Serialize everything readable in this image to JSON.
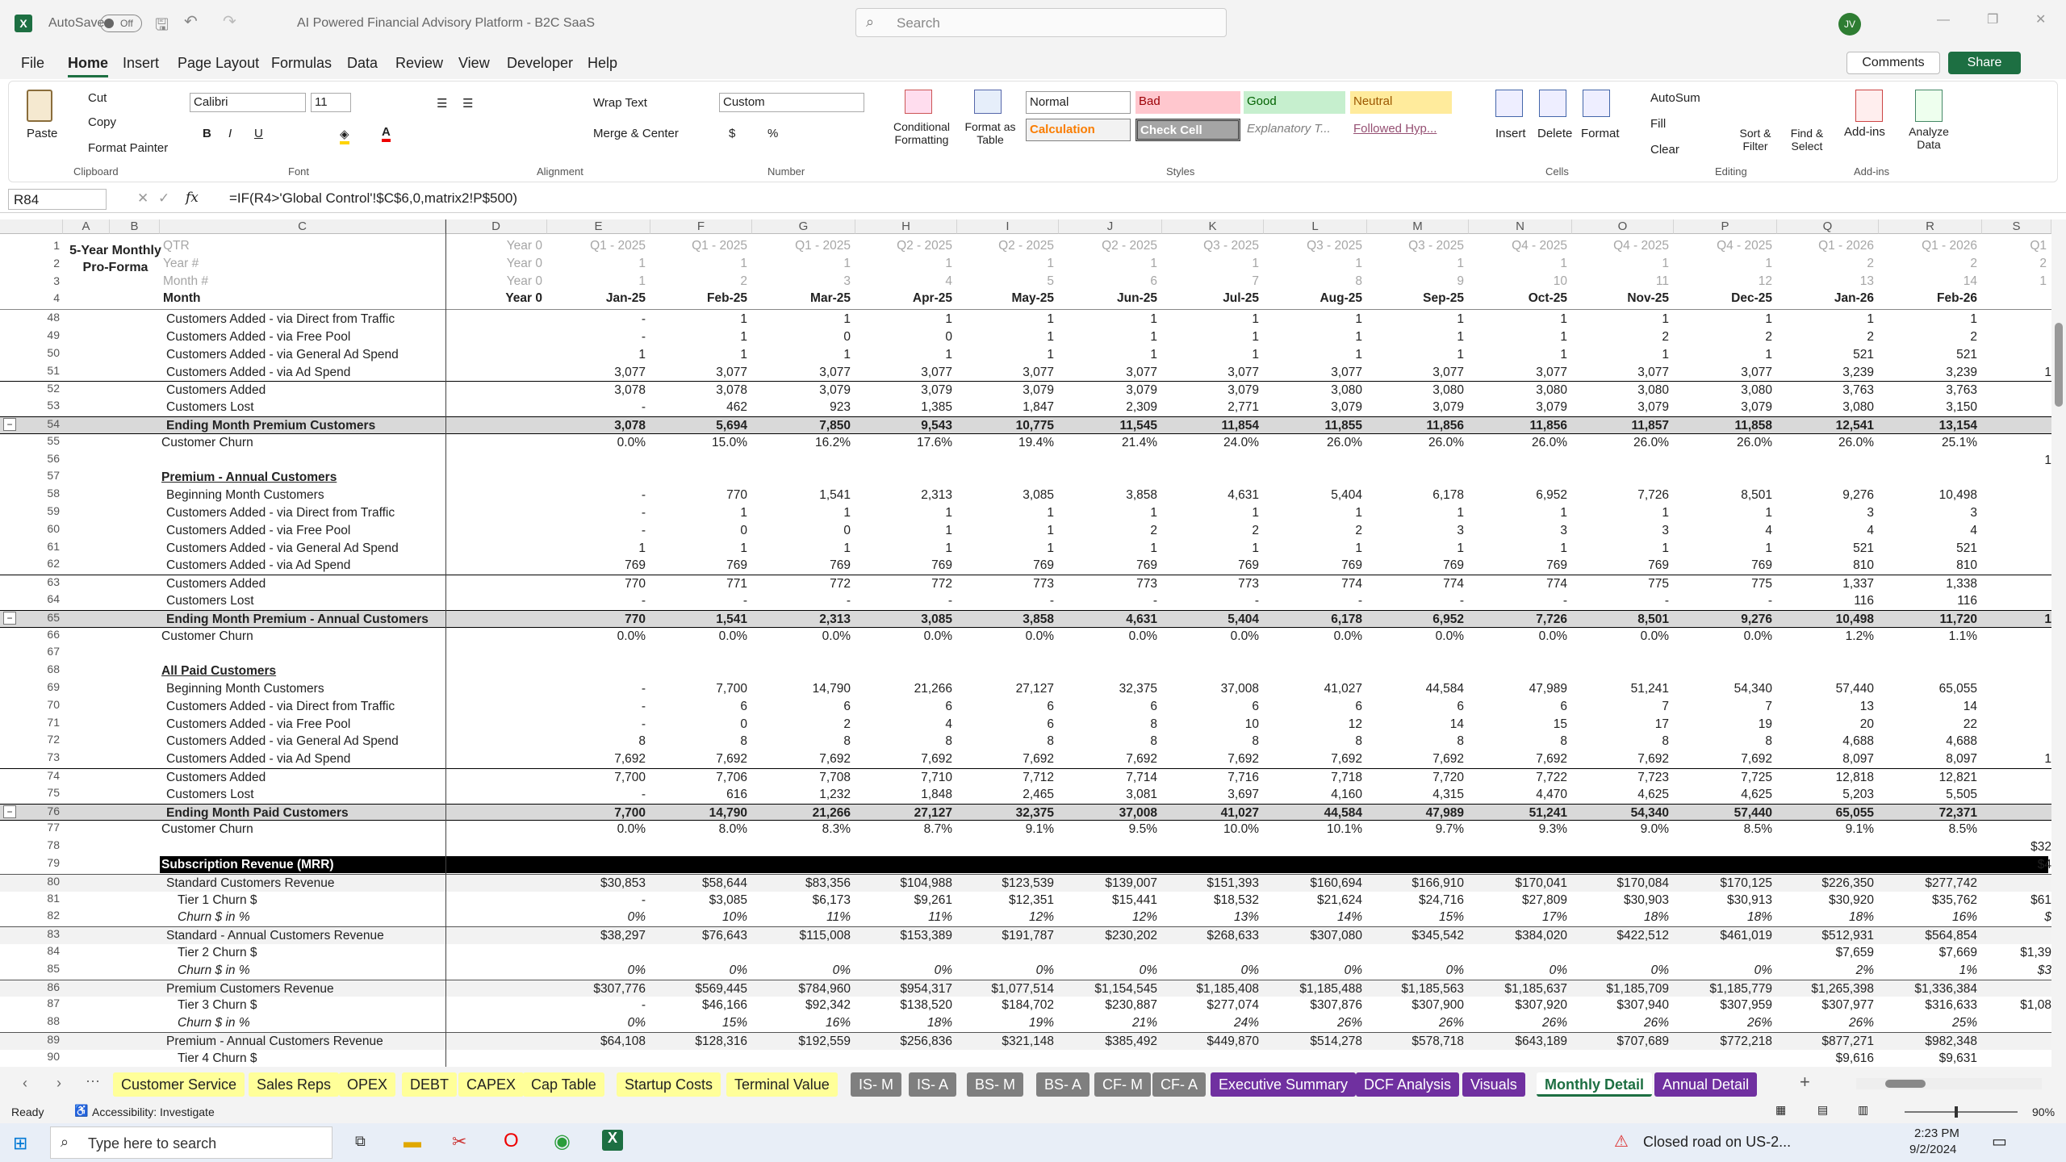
{
  "app": {
    "title": "AI Powered Financial Advisory Platform - B2C SaaS",
    "autosave": "AutoSave",
    "autosave_state": "Off",
    "search_placeholder": "Search",
    "user_initials": "JV"
  },
  "menu": [
    "File",
    "Home",
    "Insert",
    "Page Layout",
    "Formulas",
    "Data",
    "Review",
    "View",
    "Developer",
    "Help"
  ],
  "menu_right": {
    "comments": "Comments",
    "share": "Share"
  },
  "ribbon": {
    "clipboard": {
      "paste": "Paste",
      "cut": "Cut",
      "copy": "Copy",
      "format_painter": "Format Painter",
      "group": "Clipboard"
    },
    "font": {
      "name": "Calibri",
      "size": "11",
      "group": "Font"
    },
    "alignment": {
      "wrap": "Wrap Text",
      "merge": "Merge & Center",
      "group": "Alignment"
    },
    "number": {
      "format": "Custom",
      "group": "Number"
    },
    "styles": {
      "cond": "Conditional Formatting",
      "table": "Format as Table",
      "normal": "Normal",
      "bad": "Bad",
      "good": "Good",
      "neutral": "Neutral",
      "calc": "Calculation",
      "check": "Check Cell",
      "expl": "Explanatory T...",
      "follow": "Followed Hyp...",
      "group": "Styles"
    },
    "cells": {
      "insert": "Insert",
      "delete": "Delete",
      "format": "Format",
      "group": "Cells"
    },
    "editing": {
      "autosum": "AutoSum",
      "fill": "Fill",
      "clear": "Clear",
      "sort": "Sort & Filter",
      "find": "Find & Select",
      "group": "Editing"
    },
    "addins": {
      "addins": "Add-ins",
      "analyze": "Analyze Data",
      "group": "Add-ins"
    }
  },
  "formula_bar": {
    "name_box": "R84",
    "formula": "=IF(R4>'Global Control'!$C$6,0,matrix2!P$500)"
  },
  "columns": [
    "A",
    "B",
    "C",
    "D",
    "E",
    "F",
    "G",
    "H",
    "I",
    "J",
    "K",
    "L",
    "M",
    "N",
    "O",
    "P",
    "Q",
    "R",
    "S"
  ],
  "header_rows": {
    "title": "5-Year Monthly Pro-Forma",
    "r1": [
      "QTR",
      "Year 0",
      "Q1 - 2025",
      "Q1 - 2025",
      "Q1 - 2025",
      "Q2 - 2025",
      "Q2 - 2025",
      "Q2 - 2025",
      "Q3 - 2025",
      "Q3 - 2025",
      "Q3 - 2025",
      "Q4 - 2025",
      "Q4 - 2025",
      "Q4 - 2025",
      "Q1 - 2026",
      "Q1 - 2026",
      "Q1"
    ],
    "r2": [
      "Year #",
      "Year 0",
      "1",
      "1",
      "1",
      "1",
      "1",
      "1",
      "1",
      "1",
      "1",
      "1",
      "1",
      "1",
      "2",
      "2",
      "2"
    ],
    "r3": [
      "Month #",
      "Year 0",
      "1",
      "2",
      "3",
      "4",
      "5",
      "6",
      "7",
      "8",
      "9",
      "10",
      "11",
      "12",
      "13",
      "14",
      "1"
    ],
    "r4": [
      "Month",
      "Year 0",
      "Jan-25",
      "Feb-25",
      "Mar-25",
      "Apr-25",
      "May-25",
      "Jun-25",
      "Jul-25",
      "Aug-25",
      "Sep-25",
      "Oct-25",
      "Nov-25",
      "Dec-25",
      "Jan-26",
      "Feb-26",
      ""
    ]
  },
  "rows": [
    {
      "n": "48",
      "l": "Customers Added - via Direct from Traffic",
      "v": [
        "",
        "-",
        "1",
        "1",
        "1",
        "1",
        "1",
        "1",
        "1",
        "1",
        "1",
        "1",
        "1",
        "1",
        "1"
      ]
    },
    {
      "n": "49",
      "l": "Customers Added - via Free Pool",
      "v": [
        "",
        "-",
        "1",
        "0",
        "0",
        "1",
        "1",
        "1",
        "1",
        "1",
        "1",
        "2",
        "2",
        "2",
        "2"
      ]
    },
    {
      "n": "50",
      "l": "Customers Added - via General Ad Spend",
      "v": [
        "",
        "1",
        "1",
        "1",
        "1",
        "1",
        "1",
        "1",
        "1",
        "1",
        "1",
        "1",
        "1",
        "521",
        "521"
      ]
    },
    {
      "n": "51",
      "l": "Customers Added - via Ad Spend",
      "v": [
        "",
        "3,077",
        "3,077",
        "3,077",
        "3,077",
        "3,077",
        "3,077",
        "3,077",
        "3,077",
        "3,077",
        "3,077",
        "3,077",
        "3,077",
        "3,239",
        "3,239"
      ]
    },
    {
      "n": "52",
      "l": "Customers Added",
      "v": [
        "",
        "3,078",
        "3,078",
        "3,079",
        "3,079",
        "3,079",
        "3,079",
        "3,079",
        "3,080",
        "3,080",
        "3,080",
        "3,080",
        "3,080",
        "3,763",
        "3,763"
      ],
      "t": "top"
    },
    {
      "n": "53",
      "l": "Customers Lost",
      "v": [
        "",
        "-",
        "462",
        "923",
        "1,385",
        "1,847",
        "2,309",
        "2,771",
        "3,079",
        "3,079",
        "3,079",
        "3,079",
        "3,079",
        "3,080",
        "3,150"
      ]
    },
    {
      "n": "54",
      "l": "Ending Month Premium Customers",
      "v": [
        "",
        "3,078",
        "5,694",
        "7,850",
        "9,543",
        "10,775",
        "11,545",
        "11,854",
        "11,855",
        "11,856",
        "11,856",
        "11,857",
        "11,858",
        "12,541",
        "13,154"
      ],
      "t": "end"
    },
    {
      "n": "55",
      "l": "Customer Churn",
      "v": [
        "",
        "0.0%",
        "15.0%",
        "16.2%",
        "17.6%",
        "19.4%",
        "21.4%",
        "24.0%",
        "26.0%",
        "26.0%",
        "26.0%",
        "26.0%",
        "26.0%",
        "26.0%",
        "25.1%"
      ],
      "t": "plain"
    },
    {
      "n": "56",
      "l": "",
      "v": []
    },
    {
      "n": "57",
      "l": "Premium - Annual Customers",
      "v": [],
      "t": "sec"
    },
    {
      "n": "58",
      "l": "Beginning Month Customers",
      "v": [
        "",
        "-",
        "770",
        "1,541",
        "2,313",
        "3,085",
        "3,858",
        "4,631",
        "5,404",
        "6,178",
        "6,952",
        "7,726",
        "8,501",
        "9,276",
        "10,498"
      ]
    },
    {
      "n": "59",
      "l": "Customers Added - via Direct from Traffic",
      "v": [
        "",
        "-",
        "1",
        "1",
        "1",
        "1",
        "1",
        "1",
        "1",
        "1",
        "1",
        "1",
        "1",
        "3",
        "3"
      ]
    },
    {
      "n": "60",
      "l": "Customers Added - via Free Pool",
      "v": [
        "",
        "-",
        "0",
        "0",
        "1",
        "1",
        "2",
        "2",
        "2",
        "3",
        "3",
        "3",
        "4",
        "4",
        "4"
      ]
    },
    {
      "n": "61",
      "l": "Customers Added - via General Ad Spend",
      "v": [
        "",
        "1",
        "1",
        "1",
        "1",
        "1",
        "1",
        "1",
        "1",
        "1",
        "1",
        "1",
        "1",
        "521",
        "521"
      ]
    },
    {
      "n": "62",
      "l": "Customers Added - via Ad Spend",
      "v": [
        "",
        "769",
        "769",
        "769",
        "769",
        "769",
        "769",
        "769",
        "769",
        "769",
        "769",
        "769",
        "769",
        "810",
        "810"
      ]
    },
    {
      "n": "63",
      "l": "Customers Added",
      "v": [
        "",
        "770",
        "771",
        "772",
        "772",
        "773",
        "773",
        "773",
        "774",
        "774",
        "774",
        "775",
        "775",
        "1,337",
        "1,338"
      ],
      "t": "top"
    },
    {
      "n": "64",
      "l": "Customers Lost",
      "v": [
        "",
        "-",
        "-",
        "-",
        "-",
        "-",
        "-",
        "-",
        "-",
        "-",
        "-",
        "-",
        "-",
        "116",
        "116"
      ]
    },
    {
      "n": "65",
      "l": "Ending Month Premium - Annual Customers",
      "v": [
        "",
        "770",
        "1,541",
        "2,313",
        "3,085",
        "3,858",
        "4,631",
        "5,404",
        "6,178",
        "6,952",
        "7,726",
        "8,501",
        "9,276",
        "10,498",
        "11,720"
      ],
      "t": "end"
    },
    {
      "n": "66",
      "l": "Customer Churn",
      "v": [
        "",
        "0.0%",
        "0.0%",
        "0.0%",
        "0.0%",
        "0.0%",
        "0.0%",
        "0.0%",
        "0.0%",
        "0.0%",
        "0.0%",
        "0.0%",
        "0.0%",
        "1.2%",
        "1.1%"
      ],
      "t": "plain"
    },
    {
      "n": "67",
      "l": "",
      "v": []
    },
    {
      "n": "68",
      "l": "All Paid Customers",
      "v": [],
      "t": "sec"
    },
    {
      "n": "69",
      "l": "Beginning Month Customers",
      "v": [
        "",
        "-",
        "7,700",
        "14,790",
        "21,266",
        "27,127",
        "32,375",
        "37,008",
        "41,027",
        "44,584",
        "47,989",
        "51,241",
        "54,340",
        "57,440",
        "65,055"
      ]
    },
    {
      "n": "70",
      "l": "Customers Added - via Direct from Traffic",
      "v": [
        "",
        "-",
        "6",
        "6",
        "6",
        "6",
        "6",
        "6",
        "6",
        "6",
        "6",
        "7",
        "7",
        "13",
        "14"
      ]
    },
    {
      "n": "71",
      "l": "Customers Added - via Free Pool",
      "v": [
        "",
        "-",
        "0",
        "2",
        "4",
        "6",
        "8",
        "10",
        "12",
        "14",
        "15",
        "17",
        "19",
        "20",
        "22"
      ]
    },
    {
      "n": "72",
      "l": "Customers Added - via General Ad Spend",
      "v": [
        "",
        "8",
        "8",
        "8",
        "8",
        "8",
        "8",
        "8",
        "8",
        "8",
        "8",
        "8",
        "8",
        "4,688",
        "4,688"
      ]
    },
    {
      "n": "73",
      "l": "Customers Added - via Ad Spend",
      "v": [
        "",
        "7,692",
        "7,692",
        "7,692",
        "7,692",
        "7,692",
        "7,692",
        "7,692",
        "7,692",
        "7,692",
        "7,692",
        "7,692",
        "7,692",
        "8,097",
        "8,097"
      ]
    },
    {
      "n": "74",
      "l": "Customers Added",
      "v": [
        "",
        "7,700",
        "7,706",
        "7,708",
        "7,710",
        "7,712",
        "7,714",
        "7,716",
        "7,718",
        "7,720",
        "7,722",
        "7,723",
        "7,725",
        "12,818",
        "12,821"
      ],
      "t": "top"
    },
    {
      "n": "75",
      "l": "Customers Lost",
      "v": [
        "",
        "-",
        "616",
        "1,232",
        "1,848",
        "2,465",
        "3,081",
        "3,697",
        "4,160",
        "4,315",
        "4,470",
        "4,625",
        "4,625",
        "5,203",
        "5,505"
      ]
    },
    {
      "n": "76",
      "l": "Ending Month Paid Customers",
      "v": [
        "",
        "7,700",
        "14,790",
        "21,266",
        "27,127",
        "32,375",
        "37,008",
        "41,027",
        "44,584",
        "47,989",
        "51,241",
        "54,340",
        "57,440",
        "65,055",
        "72,371"
      ],
      "t": "end"
    },
    {
      "n": "77",
      "l": "Customer Churn",
      "v": [
        "",
        "0.0%",
        "8.0%",
        "8.3%",
        "8.7%",
        "9.1%",
        "9.5%",
        "10.0%",
        "10.1%",
        "9.7%",
        "9.3%",
        "9.0%",
        "8.5%",
        "9.1%",
        "8.5%"
      ],
      "t": "plain"
    },
    {
      "n": "78",
      "l": "",
      "v": []
    },
    {
      "n": "79",
      "l": "Subscription Revenue (MRR)",
      "v": [],
      "t": "black"
    },
    {
      "n": "80",
      "l": "Standard Customers Revenue",
      "v": [
        "",
        "$30,853",
        "$58,644",
        "$83,356",
        "$104,988",
        "$123,539",
        "$139,007",
        "$151,393",
        "$160,694",
        "$166,910",
        "$170,041",
        "$170,084",
        "$170,125",
        "$226,350",
        "$277,742"
      ],
      "t": "rev"
    },
    {
      "n": "81",
      "l": "Tier 1 Churn $",
      "v": [
        "",
        "-",
        "$3,085",
        "$6,173",
        "$9,261",
        "$12,351",
        "$15,441",
        "$18,532",
        "$21,624",
        "$24,716",
        "$27,809",
        "$30,903",
        "$30,913",
        "$30,920",
        "$35,762"
      ],
      "t": "ind"
    },
    {
      "n": "82",
      "l": "Churn $ in %",
      "v": [
        "",
        "0%",
        "10%",
        "11%",
        "11%",
        "12%",
        "12%",
        "13%",
        "14%",
        "15%",
        "17%",
        "18%",
        "18%",
        "18%",
        "16%"
      ],
      "t": "pct"
    },
    {
      "n": "83",
      "l": "Standard - Annual Customers Revenue",
      "v": [
        "",
        "$38,297",
        "$76,643",
        "$115,008",
        "$153,389",
        "$191,787",
        "$230,202",
        "$268,633",
        "$307,080",
        "$345,542",
        "$384,020",
        "$422,512",
        "$461,019",
        "$512,931",
        "$564,854"
      ],
      "t": "rev"
    },
    {
      "n": "84",
      "l": "Tier 2 Churn $",
      "v": [
        "",
        "",
        "",
        "",
        "",
        "",
        "",
        "",
        "",
        "",
        "",
        "",
        "",
        "$7,659",
        "$7,669"
      ],
      "t": "ind"
    },
    {
      "n": "85",
      "l": "Churn $ in %",
      "v": [
        "",
        "0%",
        "0%",
        "0%",
        "0%",
        "0%",
        "0%",
        "0%",
        "0%",
        "0%",
        "0%",
        "0%",
        "0%",
        "2%",
        "1%"
      ],
      "t": "pct"
    },
    {
      "n": "86",
      "l": "Premium Customers Revenue",
      "v": [
        "",
        "$307,776",
        "$569,445",
        "$784,960",
        "$954,317",
        "$1,077,514",
        "$1,154,545",
        "$1,185,408",
        "$1,185,488",
        "$1,185,563",
        "$1,185,637",
        "$1,185,709",
        "$1,185,779",
        "$1,265,398",
        "$1,336,384"
      ],
      "t": "rev"
    },
    {
      "n": "87",
      "l": "Tier 3 Churn $",
      "v": [
        "",
        "-",
        "$46,166",
        "$92,342",
        "$138,520",
        "$184,702",
        "$230,887",
        "$277,074",
        "$307,876",
        "$307,900",
        "$307,920",
        "$307,940",
        "$307,959",
        "$307,977",
        "$316,633"
      ],
      "t": "ind"
    },
    {
      "n": "88",
      "l": "Churn $ in %",
      "v": [
        "",
        "0%",
        "15%",
        "16%",
        "18%",
        "19%",
        "21%",
        "24%",
        "26%",
        "26%",
        "26%",
        "26%",
        "26%",
        "26%",
        "25%"
      ],
      "t": "pct"
    },
    {
      "n": "89",
      "l": "Premium - Annual Customers Revenue",
      "v": [
        "",
        "$64,108",
        "$128,316",
        "$192,559",
        "$256,836",
        "$321,148",
        "$385,492",
        "$449,870",
        "$514,278",
        "$578,718",
        "$643,189",
        "$707,689",
        "$772,218",
        "$877,271",
        "$982,348"
      ],
      "t": "rev"
    },
    {
      "n": "90",
      "l": "Tier 4 Churn $",
      "v": [
        "",
        "",
        "",
        "",
        "",
        "",
        "",
        "",
        "",
        "",
        "",
        "",
        "",
        "$9,616",
        "$9,631"
      ],
      "t": "ind"
    }
  ],
  "col_s_tail": [
    "",
    "",
    "1",
    "",
    "",
    "",
    "",
    "1",
    "",
    "",
    "",
    "",
    "1",
    "",
    "",
    "",
    "",
    "",
    "",
    "",
    "",
    "1",
    "",
    "",
    "",
    "",
    "",
    "",
    "",
    "1",
    "",
    "",
    "",
    "",
    "$32",
    "$4",
    "",
    "$61",
    "$",
    "",
    "$1,39",
    "$3",
    "",
    "$1,08",
    ""
  ],
  "sheet_tabs": [
    "Customer Service",
    "Sales Reps",
    "OPEX",
    "DEBT",
    "CAPEX",
    "Cap Table",
    "Startup Costs",
    "Terminal Value",
    "IS- M",
    "IS- A",
    "BS- M",
    "BS- A",
    "CF- M",
    "CF- A",
    "Executive Summary",
    "DCF Analysis",
    "Visuals",
    "Monthly Detail",
    "Annual Detail"
  ],
  "status": {
    "ready": "Ready",
    "accessibility": "Accessibility: Investigate",
    "zoom": "90%"
  },
  "taskbar": {
    "search": "Type here to search",
    "news": "Closed road on US-2...",
    "time": "2:23 PM",
    "date": "9/2/2024"
  }
}
